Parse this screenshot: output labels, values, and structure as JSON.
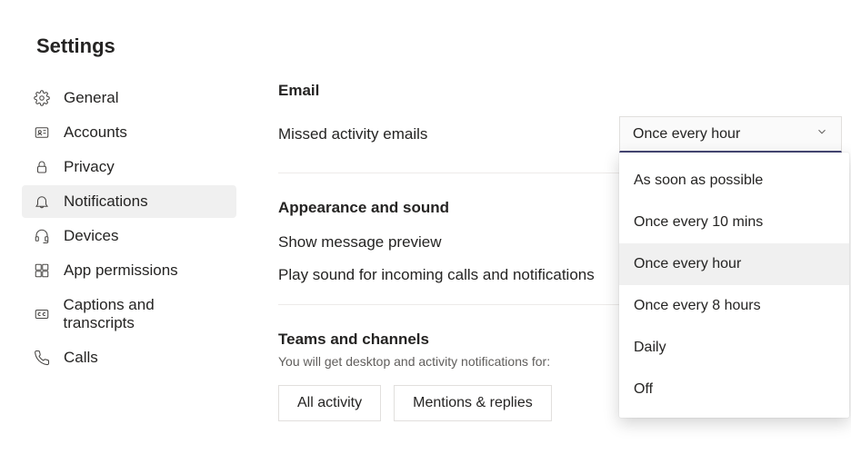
{
  "page_title": "Settings",
  "sidebar": {
    "items": [
      {
        "label": "General"
      },
      {
        "label": "Accounts"
      },
      {
        "label": "Privacy"
      },
      {
        "label": "Notifications"
      },
      {
        "label": "Devices"
      },
      {
        "label": "App permissions"
      },
      {
        "label": "Captions and transcripts"
      },
      {
        "label": "Calls"
      }
    ]
  },
  "sections": {
    "email": {
      "heading": "Email",
      "missed_label": "Missed activity emails",
      "dropdown_value": "Once every hour",
      "dropdown_options": [
        "As soon as possible",
        "Once every 10 mins",
        "Once every hour",
        "Once every 8 hours",
        "Daily",
        "Off"
      ]
    },
    "appearance": {
      "heading": "Appearance and sound",
      "preview_label": "Show message preview",
      "sound_label": "Play sound for incoming calls and notifications"
    },
    "teams": {
      "heading": "Teams and channels",
      "sub": "You will get desktop and activity notifications for:",
      "chip_all": "All activity",
      "chip_mentions": "Mentions & replies"
    }
  }
}
